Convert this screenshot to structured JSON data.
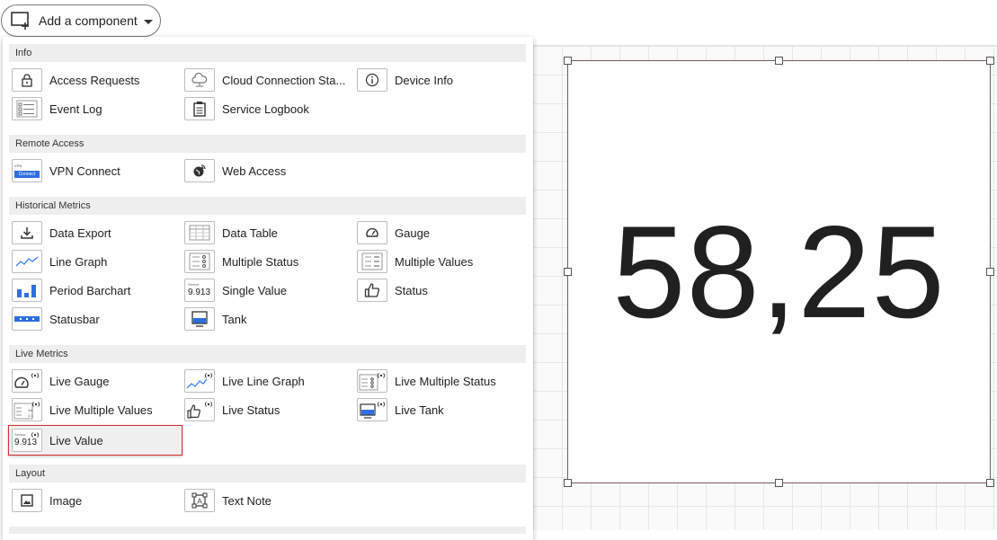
{
  "toolbar": {
    "add_label": "Add a component"
  },
  "widget": {
    "value": "58,25"
  },
  "menu": {
    "info": {
      "title": "Info",
      "items": [
        "Access Requests",
        "Cloud Connection Sta...",
        "Device Info",
        "Event Log",
        "Service Logbook"
      ]
    },
    "remote": {
      "title": "Remote Access",
      "items": [
        "VPN Connect",
        "Web Access"
      ],
      "vpn_icon_text": "VPN",
      "vpn_icon_button": "Connect"
    },
    "historical": {
      "title": "Historical Metrics",
      "items": [
        "Data Export",
        "Data Table",
        "Gauge",
        "Line Graph",
        "Multiple Status",
        "Multiple Values",
        "Period Barchart",
        "Single Value",
        "Status",
        "Statusbar",
        "Tank"
      ]
    },
    "live": {
      "title": "Live Metrics",
      "items": [
        "Live Gauge",
        "Live Line Graph",
        "Live Multiple Status",
        "Live Multiple Values",
        "Live Status",
        "Live Tank",
        "Live Value"
      ]
    },
    "layout": {
      "title": "Layout",
      "items": [
        "Image",
        "Text Note"
      ]
    },
    "icon_value_small": "Sensor",
    "icon_value_num": "9.913",
    "icon_tiny_1": "Val",
    "icon_tiny_2": "4.1"
  }
}
